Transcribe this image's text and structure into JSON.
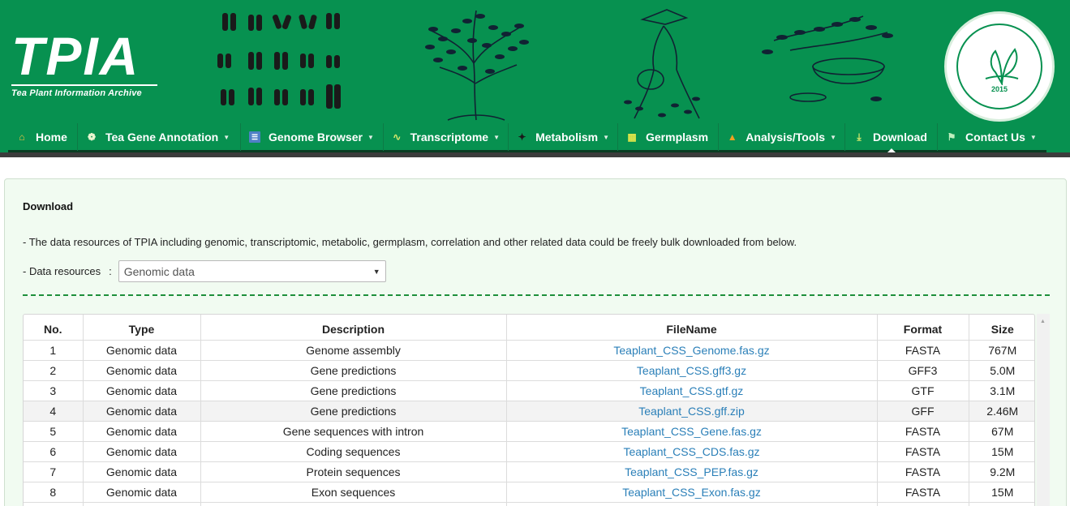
{
  "header": {
    "logo_text": "TPIA",
    "logo_subtitle": "Tea Plant Information Archive",
    "seal_year": "2015"
  },
  "nav": {
    "items": [
      {
        "label": "Home",
        "icon": "home-icon",
        "dropdown": false
      },
      {
        "label": "Tea Gene Annotation",
        "icon": "leaf-icon",
        "dropdown": true
      },
      {
        "label": "Genome Browser",
        "icon": "book-icon",
        "dropdown": true
      },
      {
        "label": "Transcriptome",
        "icon": "dna-icon",
        "dropdown": true
      },
      {
        "label": "Metabolism",
        "icon": "molecule-icon",
        "dropdown": true
      },
      {
        "label": "Germplasm",
        "icon": "grid-icon",
        "dropdown": false
      },
      {
        "label": "Analysis/Tools",
        "icon": "tools-icon",
        "dropdown": true
      },
      {
        "label": "Download",
        "icon": "download-icon",
        "dropdown": false,
        "active": true
      },
      {
        "label": "Contact Us",
        "icon": "flag-icon",
        "dropdown": true
      }
    ]
  },
  "panel": {
    "title": "Download",
    "intro": "- The data resources of TPIA including genomic, transcriptomic, metabolic, germplasm, correlation and other related data could be freely bulk downloaded from below.",
    "resources_label": "- Data resources",
    "resources_colon": ":",
    "resources_selected": "Genomic data"
  },
  "table": {
    "headers": [
      "No.",
      "Type",
      "Description",
      "FileName",
      "Format",
      "Size"
    ],
    "rows": [
      {
        "no": "1",
        "type": "Genomic data",
        "description": "Genome assembly",
        "file": "Teaplant_CSS_Genome.fas.gz",
        "format": "FASTA",
        "size": "767M"
      },
      {
        "no": "2",
        "type": "Genomic data",
        "description": "Gene predictions",
        "file": "Teaplant_CSS.gff3.gz",
        "format": "GFF3",
        "size": "5.0M"
      },
      {
        "no": "3",
        "type": "Genomic data",
        "description": "Gene predictions",
        "file": "Teaplant_CSS.gtf.gz",
        "format": "GTF",
        "size": "3.1M"
      },
      {
        "no": "4",
        "type": "Genomic data",
        "description": "Gene predictions",
        "file": "Teaplant_CSS.gff.zip",
        "format": "GFF",
        "size": "2.46M"
      },
      {
        "no": "5",
        "type": "Genomic data",
        "description": "Gene sequences with intron",
        "file": "Teaplant_CSS_Gene.fas.gz",
        "format": "FASTA",
        "size": "67M"
      },
      {
        "no": "6",
        "type": "Genomic data",
        "description": "Coding sequences",
        "file": "Teaplant_CSS_CDS.fas.gz",
        "format": "FASTA",
        "size": "15M"
      },
      {
        "no": "7",
        "type": "Genomic data",
        "description": "Protein sequences",
        "file": "Teaplant_CSS_PEP.fas.gz",
        "format": "FASTA",
        "size": "9.2M"
      },
      {
        "no": "8",
        "type": "Genomic data",
        "description": "Exon sequences",
        "file": "Teaplant_CSS_Exon.fas.gz",
        "format": "FASTA",
        "size": "15M"
      }
    ]
  },
  "colors": {
    "brand_green": "#079150",
    "link": "#2a7fb8",
    "panel_bg": "#f1fbf1"
  }
}
